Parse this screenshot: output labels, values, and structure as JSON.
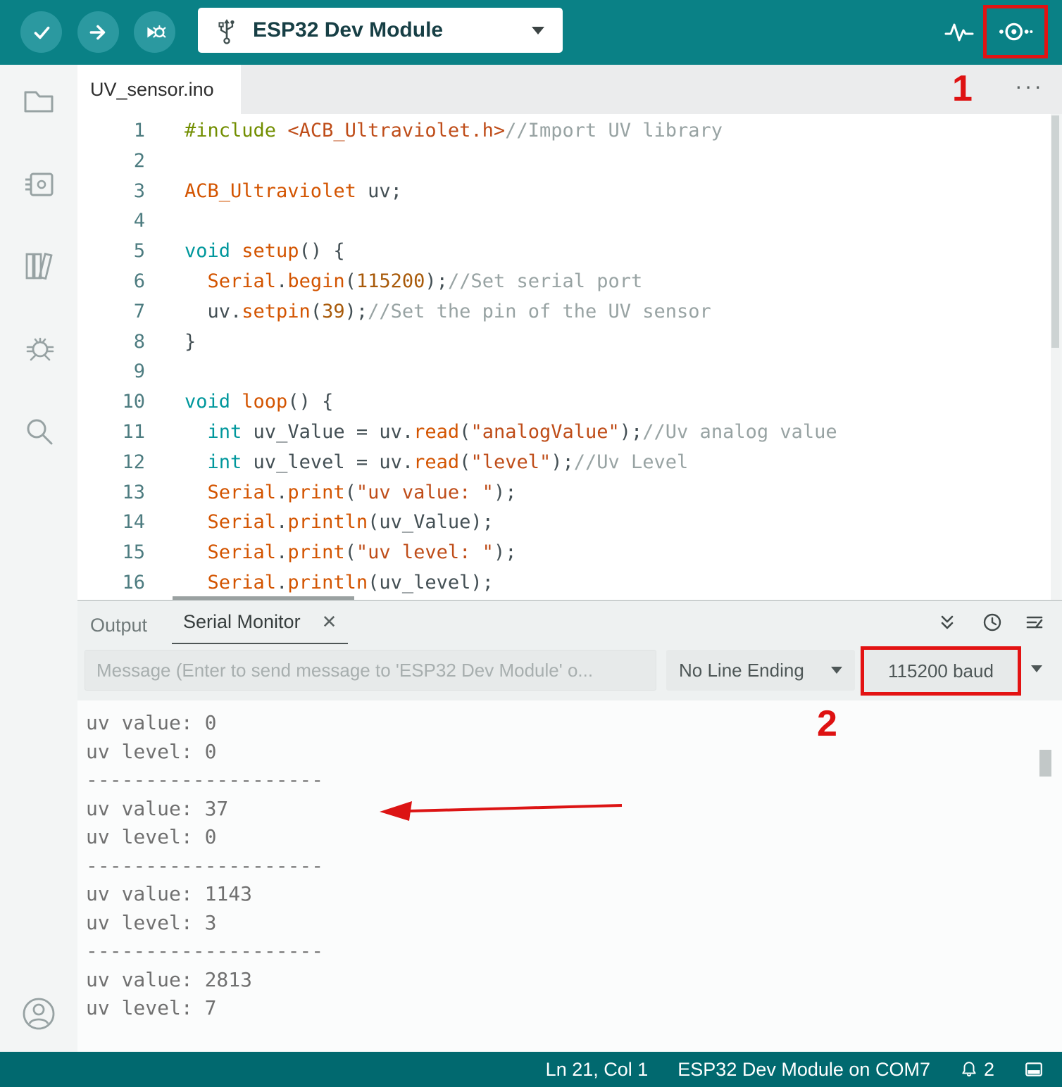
{
  "toolbar": {
    "board": "ESP32 Dev Module"
  },
  "editor": {
    "tab": "UV_sensor.ino",
    "more": "···",
    "lines": [
      {
        "num": "1",
        "segs": [
          {
            "t": "#include ",
            "c": "pre"
          },
          {
            "t": "<ACB_Ultraviolet.h>",
            "c": "str"
          },
          {
            "t": "//Import UV library",
            "c": "com"
          }
        ]
      },
      {
        "num": "2",
        "segs": []
      },
      {
        "num": "3",
        "segs": [
          {
            "t": "ACB_Ultraviolet",
            "c": "fn"
          },
          {
            "t": " uv;",
            "c": "pl"
          }
        ]
      },
      {
        "num": "4",
        "segs": []
      },
      {
        "num": "5",
        "segs": [
          {
            "t": "void ",
            "c": "kw"
          },
          {
            "t": "setup",
            "c": "fn"
          },
          {
            "t": "() {",
            "c": "pl"
          }
        ]
      },
      {
        "num": "6",
        "segs": [
          {
            "t": "  ",
            "c": "pl"
          },
          {
            "t": "Serial",
            "c": "fn"
          },
          {
            "t": ".",
            "c": "pl"
          },
          {
            "t": "begin",
            "c": "fn"
          },
          {
            "t": "(",
            "c": "pl"
          },
          {
            "t": "115200",
            "c": "num"
          },
          {
            "t": ");",
            "c": "pl"
          },
          {
            "t": "//Set serial port",
            "c": "com"
          }
        ]
      },
      {
        "num": "7",
        "segs": [
          {
            "t": "  uv.",
            "c": "pl"
          },
          {
            "t": "setpin",
            "c": "fn"
          },
          {
            "t": "(",
            "c": "pl"
          },
          {
            "t": "39",
            "c": "num"
          },
          {
            "t": ");",
            "c": "pl"
          },
          {
            "t": "//Set the pin of the UV sensor",
            "c": "com"
          }
        ]
      },
      {
        "num": "8",
        "segs": [
          {
            "t": "}",
            "c": "pl"
          }
        ]
      },
      {
        "num": "9",
        "segs": []
      },
      {
        "num": "10",
        "segs": [
          {
            "t": "void ",
            "c": "kw"
          },
          {
            "t": "loop",
            "c": "fn"
          },
          {
            "t": "() {",
            "c": "pl"
          }
        ]
      },
      {
        "num": "11",
        "segs": [
          {
            "t": "  ",
            "c": "pl"
          },
          {
            "t": "int",
            "c": "kw"
          },
          {
            "t": " uv_Value = uv.",
            "c": "pl"
          },
          {
            "t": "read",
            "c": "fn"
          },
          {
            "t": "(",
            "c": "pl"
          },
          {
            "t": "\"analogValue\"",
            "c": "str"
          },
          {
            "t": ");",
            "c": "pl"
          },
          {
            "t": "//Uv analog value",
            "c": "com"
          }
        ]
      },
      {
        "num": "12",
        "segs": [
          {
            "t": "  ",
            "c": "pl"
          },
          {
            "t": "int",
            "c": "kw"
          },
          {
            "t": " uv_level = uv.",
            "c": "pl"
          },
          {
            "t": "read",
            "c": "fn"
          },
          {
            "t": "(",
            "c": "pl"
          },
          {
            "t": "\"level\"",
            "c": "str"
          },
          {
            "t": ");",
            "c": "pl"
          },
          {
            "t": "//Uv Level",
            "c": "com"
          }
        ]
      },
      {
        "num": "13",
        "segs": [
          {
            "t": "  ",
            "c": "pl"
          },
          {
            "t": "Serial",
            "c": "fn"
          },
          {
            "t": ".",
            "c": "pl"
          },
          {
            "t": "print",
            "c": "fn"
          },
          {
            "t": "(",
            "c": "pl"
          },
          {
            "t": "\"uv value: \"",
            "c": "str"
          },
          {
            "t": ");",
            "c": "pl"
          }
        ]
      },
      {
        "num": "14",
        "segs": [
          {
            "t": "  ",
            "c": "pl"
          },
          {
            "t": "Serial",
            "c": "fn"
          },
          {
            "t": ".",
            "c": "pl"
          },
          {
            "t": "println",
            "c": "fn"
          },
          {
            "t": "(uv_Value);",
            "c": "pl"
          }
        ]
      },
      {
        "num": "15",
        "segs": [
          {
            "t": "  ",
            "c": "pl"
          },
          {
            "t": "Serial",
            "c": "fn"
          },
          {
            "t": ".",
            "c": "pl"
          },
          {
            "t": "print",
            "c": "fn"
          },
          {
            "t": "(",
            "c": "pl"
          },
          {
            "t": "\"uv level: \"",
            "c": "str"
          },
          {
            "t": ");",
            "c": "pl"
          }
        ]
      },
      {
        "num": "16",
        "segs": [
          {
            "t": "  ",
            "c": "pl"
          },
          {
            "t": "Serial",
            "c": "fn"
          },
          {
            "t": ".",
            "c": "pl"
          },
          {
            "t": "println",
            "c": "fn"
          },
          {
            "t": "(uv_level);",
            "c": "pl"
          }
        ]
      }
    ]
  },
  "panel": {
    "tab_output": "Output",
    "tab_serial": "Serial Monitor",
    "close_glyph": "✕",
    "message_placeholder": "Message (Enter to send message to 'ESP32 Dev Module' o...",
    "line_ending": "No Line Ending",
    "baud": "115200 baud",
    "serial_lines": [
      "uv value: 0",
      "uv level: 0",
      "--------------------",
      "uv value: 37",
      "uv level: 0",
      "--------------------",
      "uv value: 1143",
      "uv level: 3",
      "--------------------",
      "uv value: 2813",
      "uv level: 7"
    ]
  },
  "statusbar": {
    "cursor": "Ln 21, Col 1",
    "board_port": "ESP32 Dev Module on COM7",
    "notifications": "2"
  },
  "annotations": {
    "step1": "1",
    "step2": "2"
  },
  "colors": {
    "teal": "#0a8186",
    "annotation_red": "#e31313"
  }
}
